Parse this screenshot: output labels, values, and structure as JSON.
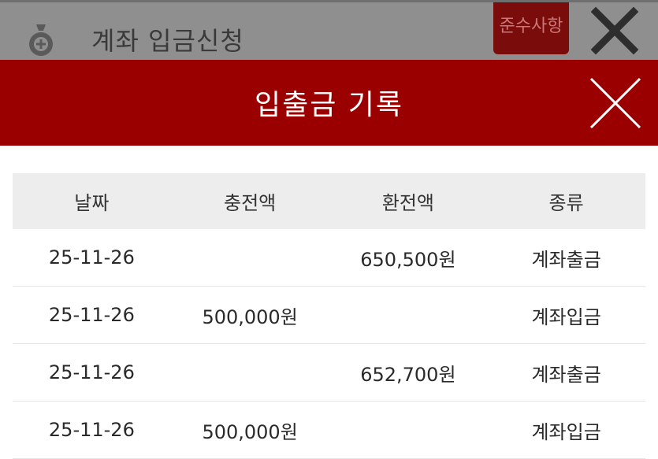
{
  "background_page": {
    "title": "계좌 입금신청",
    "notice_button_label": "준수사항",
    "icon": "money-bag-icon",
    "close_icon": "close-icon"
  },
  "modal": {
    "title": "입출금 기록",
    "close_icon": "close-icon",
    "header_color": "#9a0000"
  },
  "table": {
    "columns": [
      "날짜",
      "충전액",
      "환전액",
      "종류"
    ],
    "rows": [
      {
        "date": "25-11-26",
        "charge": "",
        "exchange": "650,500원",
        "type": "계좌출금"
      },
      {
        "date": "25-11-26",
        "charge": "500,000원",
        "exchange": "",
        "type": "계좌입금"
      },
      {
        "date": "25-11-26",
        "charge": "",
        "exchange": "652,700원",
        "type": "계좌출금"
      },
      {
        "date": "25-11-26",
        "charge": "500,000원",
        "exchange": "",
        "type": "계좌입금"
      }
    ]
  },
  "colors": {
    "charge_text": "#c41a1a",
    "exchange_text": "#2a2a8c"
  }
}
